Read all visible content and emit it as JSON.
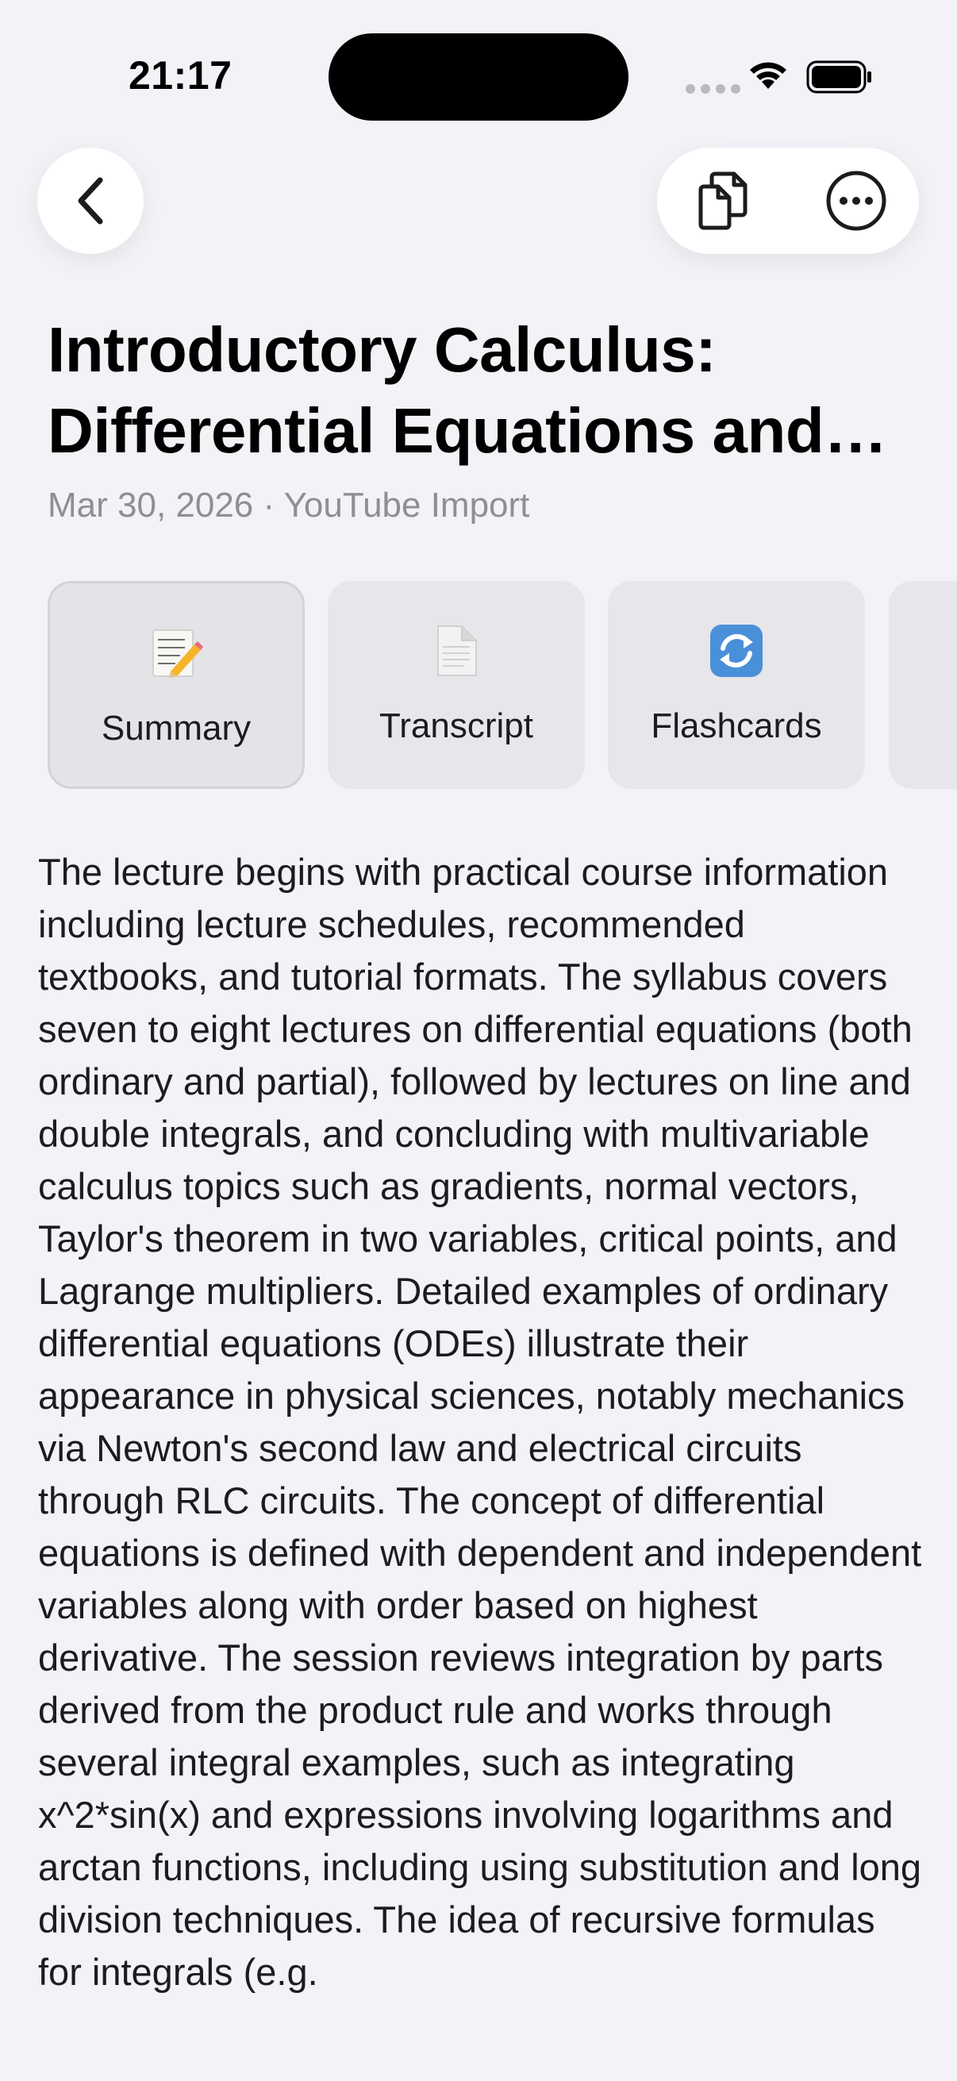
{
  "status_bar": {
    "time": "21:17"
  },
  "nav": {
    "back_icon": "chevron-left-icon",
    "copy_icon": "copy-documents-icon",
    "more_icon": "ellipsis-circle-icon"
  },
  "header": {
    "title_line1": "Introductory Calculus:",
    "title_line2": "Differential Equations and…",
    "subtitle": "Mar 30, 2026 · YouTube Import"
  },
  "tabs": [
    {
      "label": "Summary",
      "icon": "memo-pencil-icon",
      "active": true
    },
    {
      "label": "Transcript",
      "icon": "document-page-icon",
      "active": false
    },
    {
      "label": "Flashcards",
      "icon": "refresh-arrows-icon",
      "active": false
    }
  ],
  "summary": {
    "text": "The lecture begins with practical course information including lecture schedules, recommended textbooks, and tutorial formats. The syllabus covers seven to eight lectures on differential equations (both ordinary and partial), followed by lectures on line and double integrals, and concluding with multivariable calculus topics such as gradients, normal vectors, Taylor's theorem in two variables, critical points, and Lagrange multipliers. Detailed examples of ordinary differential equations (ODEs) illustrate their appearance in physical sciences, notably mechanics via Newton's second law and electrical circuits through RLC circuits. The concept of differential equations is defined with dependent and independent variables along with order based on highest derivative. The session reviews integration by parts derived from the product rule and works through several integral examples, such as integrating x^2*sin(x) and expressions involving logarithms and arctan functions, including using substitution and long division techniques. The idea of recursive formulas for integrals (e.g."
  },
  "colors": {
    "background": "#f2f2f7",
    "secondary_text": "#8e8e93",
    "tab_background": "#e6e6eb"
  }
}
